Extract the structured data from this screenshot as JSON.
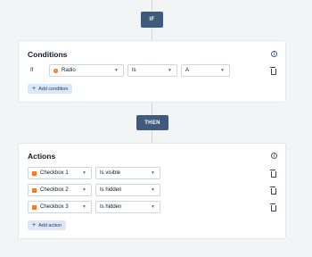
{
  "if_label": "IF",
  "then_label": "THEN",
  "conditions": {
    "title": "Conditions",
    "info_glyph": "i",
    "row": {
      "prefix": "If",
      "field": "Radio",
      "operator": "Is",
      "value": "A"
    },
    "add_label": "Add condition"
  },
  "actions": {
    "title": "Actions",
    "info_glyph": "i",
    "rows": [
      {
        "field": "Checkbox 1",
        "action": "Is visible"
      },
      {
        "field": "Checkbox 2",
        "action": "Is hidden"
      },
      {
        "field": "Checkbox 3",
        "action": "Is hidden"
      }
    ],
    "add_label": "Add action"
  },
  "icons": {
    "info": "info-icon",
    "chevron": "chevron-down-icon",
    "trash": "trash-icon",
    "plus": "plus-icon",
    "radio": "radio-field-icon",
    "checkbox": "checkbox-field-icon"
  },
  "colors": {
    "pill": "#3f5a7f",
    "field_icon": "#f97316",
    "add_button_bg": "#dce7f7"
  }
}
